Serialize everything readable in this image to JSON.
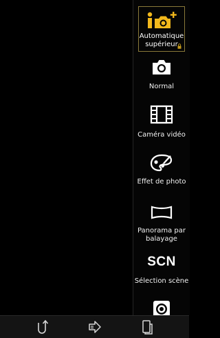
{
  "modes": [
    {
      "label": "Automatique supérieur",
      "icon": "superior-auto-icon",
      "selected": true
    },
    {
      "label": "Normal",
      "icon": "camera-icon",
      "selected": false
    },
    {
      "label": "Caméra vidéo",
      "icon": "film-icon",
      "selected": false
    },
    {
      "label": "Effet de photo",
      "icon": "palette-icon",
      "selected": false
    },
    {
      "label": "Panorama par balayage",
      "icon": "panorama-icon",
      "selected": false
    },
    {
      "label": "Sélection scène",
      "icon": "scn-icon",
      "selected": false,
      "icon_text": "SCN"
    },
    {
      "label": "",
      "icon": "selfportrait-icon",
      "selected": false
    }
  ],
  "bottom_bar": {
    "buttons": [
      "back-icon",
      "share-icon",
      "switch-camera-icon"
    ]
  },
  "colors": {
    "accent": "#f2b81c",
    "background": "#000000"
  }
}
